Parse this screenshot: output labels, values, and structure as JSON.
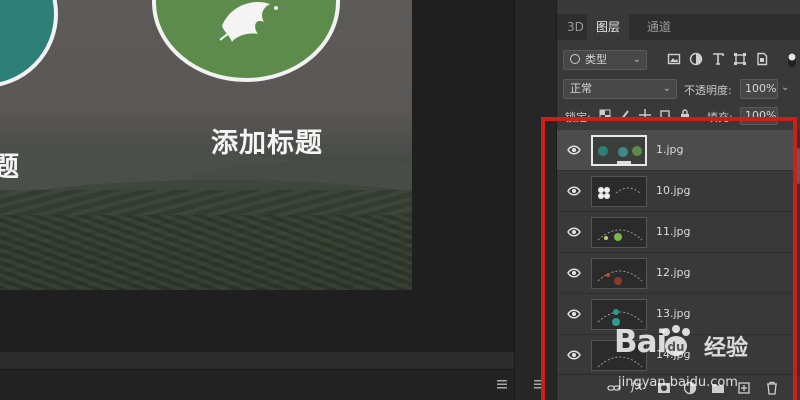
{
  "canvas": {
    "headline_main": "添加标题",
    "headline_partial": "题"
  },
  "layers_panel": {
    "tabs": [
      {
        "label": "3D",
        "active": false
      },
      {
        "label": "图层",
        "active": true
      },
      {
        "label": "通道",
        "active": false
      }
    ],
    "filter": {
      "label": "类型",
      "icon": "search-icon"
    },
    "filter_icons": [
      "image-filter-icon",
      "adjustment-filter-icon",
      "type-filter-icon",
      "shape-filter-icon",
      "smart-object-filter-icon"
    ],
    "blend_mode": "正常",
    "opacity_label": "不透明度:",
    "opacity_value": "100%",
    "lock_label": "锁定:",
    "fill_label": "填充:",
    "fill_value": "100%",
    "layers": [
      {
        "name": "1.jpg",
        "selected": true,
        "visible": true
      },
      {
        "name": "10.jpg",
        "selected": false,
        "visible": true
      },
      {
        "name": "11.jpg",
        "selected": false,
        "visible": true
      },
      {
        "name": "12.jpg",
        "selected": false,
        "visible": true
      },
      {
        "name": "13.jpg",
        "selected": false,
        "visible": true
      },
      {
        "name": "14.jpg",
        "selected": false,
        "visible": true
      }
    ],
    "bottom_icons": [
      "link-layers-icon",
      "fx-icon",
      "layer-mask-icon",
      "adjustment-layer-icon",
      "new-group-icon",
      "new-layer-icon",
      "delete-layer-icon"
    ],
    "fx_label": "fx"
  },
  "watermark": {
    "brand": "Bai",
    "brand_cn": "经验",
    "url": "jingyan.baidu.com"
  },
  "colors": {
    "annotation_red": "#cc1f1a",
    "circle_teal": "#2f7f79",
    "circle_green": "#5c8b4c",
    "panel_bg": "#393939",
    "selected_row": "#4c4c4c"
  }
}
